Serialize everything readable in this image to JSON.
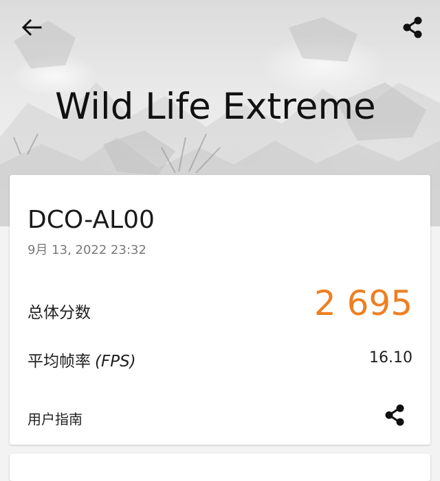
{
  "header": {
    "back_icon": "arrow-left-icon",
    "share_icon": "share-icon",
    "title": "Wild Life Extreme"
  },
  "result": {
    "device_name": "DCO-AL00",
    "timestamp": "9月 13, 2022 23:32",
    "score_label": "总体分数",
    "score_value": "2 695",
    "fps_label": "平均帧率",
    "fps_unit": "(FPS)",
    "fps_value": "16.10",
    "guide_label": "用户指南",
    "guide_share_icon": "share-icon"
  },
  "colors": {
    "score": "#ee7f22",
    "card": "#ffffff",
    "background": "#f3f3f3"
  }
}
